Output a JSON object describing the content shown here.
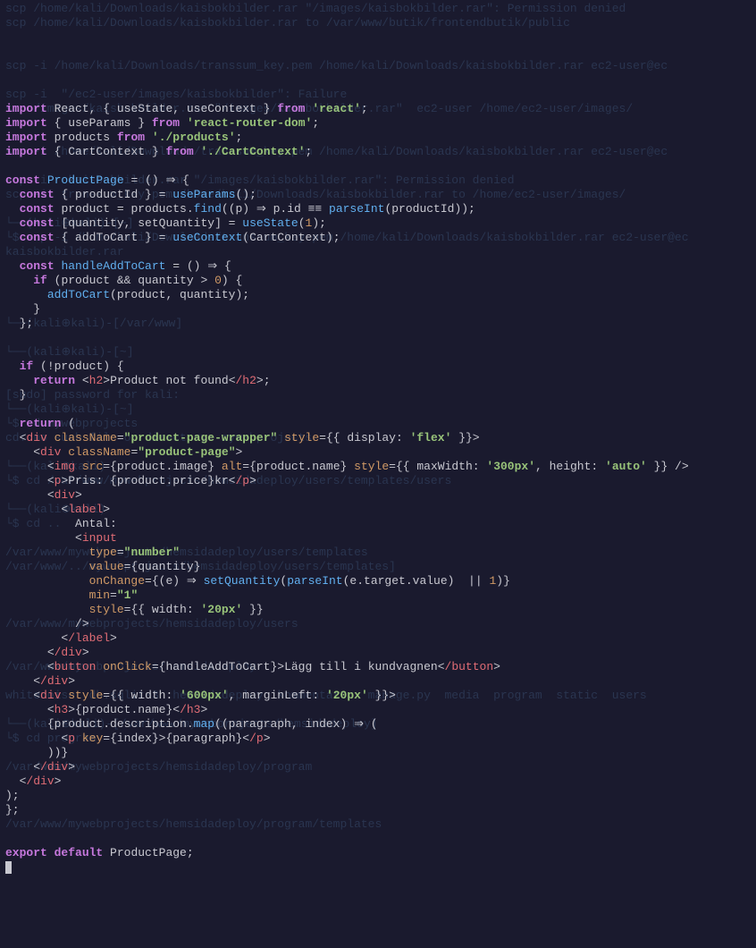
{
  "ghost_lines": [
    "scp /home/kali/Downloads/kaisbokbilder.rar \"/images/kaisbokbilder.rar\": Permission denied",
    "scp /home/kali/Downloads/kaisbokbilder.rar to /var/www/butik/frontendbutik/public",
    "",
    "",
    "scp -i /home/kali/Downloads/transsum_key.pem /home/kali/Downloads/kaisbokbilder.rar ec2-user@ec",
    "",
    "scp -i  \"/ec2-user/images/kaisbokbilder\": Failure",
    "scp /images/kaisbokbilder.rar \"/images/kaisbokbilder.rar\"  ec2-user /home/ec2-user/images/",
    "",
    "",
    "scp -i /home/kali/Downloads/transsum_key.pem /home/kali/Downloads/kaisbokbilder.rar ec2-user@ec",
    "",
    "scp -i   kaisbokbilder.rar \"/images/kaisbokbilder.rar\": Permission denied",
    "scp -i  transsum_key.pem /home/kali/Downloads/kaisbokbilder.rar to /home/ec2-user/images/",
    "",
    "└──(kali⊕kali)-[~]",
    "└$ scp -i /home/kali/Downloads/transsum_key.pem /home/kali/Downloads/kaisbokbilder.rar ec2-user@ec",
    "kaisbokbilder.rar",
    "",
    "",
    "",
    "",
    "└──(kali⊕kali)-[/var/www]",
    "",
    "└──(kali⊕kali)-[~]",
    "",
    "",
    "[sudo] password for kali:",
    "└──(kali⊕kali)-[~]",
    "└$ cd mywebprojects",
    "cd: no such file or directory: mywebprojects",
    "",
    "└──(kali⊕kali)",
    "└$ cd /var/www/mywebprojects/hemsidadeploy/users/templates/users",
    "",
    "└──(kali⊕kali)",
    "└$ cd ..",
    "",
    "/var/www/mywebprojects/hemsidadeploy/users/templates",
    "/var/www/../mywebprojects/hemsidadeploy/users/templates]",
    "",
    "",
    "",
    "/var/www/mywebprojects/hemsidadeploy/users",
    "",
    "",
    "/var/www/mywebprojects/hemsidadeploy",
    "",
    "whitenoise  db.sqlite3  hemsidadeploy  kommentarer  manage.py  media  program  static  users",
    "",
    "└──(kali⊕kali)-[/var/www/mywebprojects/hemsidadeploy]",
    "└$ cd program",
    "",
    "/var/www/mywebprojects/hemsidadeploy/program",
    "",
    "",
    "",
    "/var/www/mywebprojects/hemsidadeploy/program/templates"
  ],
  "code": {
    "l1": {
      "a": "import",
      "b": "React, { useState, useContext }",
      "c": "from",
      "d": "'react'",
      "e": ";"
    },
    "l2": {
      "a": "import",
      "b": "{ useParams }",
      "c": "from",
      "d": "'react-router-dom'",
      "e": ";"
    },
    "l3": {
      "a": "import",
      "b": "products",
      "c": "from",
      "d": "'./products'",
      "e": ";"
    },
    "l4": {
      "a": "import",
      "b": "{ CartContext }",
      "c": "from",
      "d": "'./CartContext'",
      "e": ";"
    },
    "l6": {
      "a": "const",
      "b": "ProductPage",
      "c": "= () ⇒ {"
    },
    "l7": {
      "a": "const",
      "b": "{ productId } =",
      "c": "useParams",
      "d": "();"
    },
    "l8": {
      "a": "const",
      "b": "product = products.",
      "c": "find",
      "d": "((p) ⇒ p.id ≡≡",
      "e": "parseInt",
      "f": "(productId));"
    },
    "l9": {
      "a": "const",
      "b": "[quantity, setQuantity] =",
      "c": "useState",
      "d": "(",
      "e": "1",
      "f": ");"
    },
    "l10": {
      "a": "const",
      "b": "{ addToCart } =",
      "c": "useContext",
      "d": "(CartContext);"
    },
    "l12": {
      "a": "const",
      "b": "handleAddToCart",
      "c": "= () ⇒ {"
    },
    "l13": {
      "a": "if",
      "b": "(product && quantity >",
      "c": "0",
      "d": ") {"
    },
    "l14": {
      "a": "addToCart",
      "b": "(product, quantity);"
    },
    "l15": {
      "a": "}"
    },
    "l16": {
      "a": "};"
    },
    "l19": {
      "a": "if",
      "b": "(!product) {"
    },
    "l20": {
      "a": "return",
      "b": "<",
      "c": "h2",
      "d": ">Product not found<",
      "e": "/h2",
      "f": ">;"
    },
    "l21": {
      "a": "}"
    },
    "l23": {
      "a": "return",
      "b": "("
    },
    "l24": {
      "a": "<",
      "b": "div",
      "c": "className",
      "d": "=",
      "e": "\"product-page-wrapper\"",
      "f": "style",
      "g": "={{ display:",
      "h": "'flex'",
      "i": "}}>"
    },
    "l25": {
      "a": "<",
      "b": "div",
      "c": "className",
      "d": "=",
      "e": "\"product-page\"",
      "f": ">"
    },
    "l26": {
      "a": "<",
      "b": "img",
      "c": "src",
      "d": "={product.image}",
      "e": "alt",
      "f": "={product.name}",
      "g": "style",
      "h": "={{ maxWidth:",
      "i": "'300px'",
      "j": ", height:",
      "k": "'auto'",
      "l": "}} />"
    },
    "l27": {
      "a": "<",
      "b": "p",
      "c": ">Pris: {product.price}kr<",
      "d": "/p",
      "e": ">"
    },
    "l28": {
      "a": "<",
      "b": "div",
      "c": ">"
    },
    "l29": {
      "a": "<",
      "b": "label",
      "c": ">"
    },
    "l30": {
      "a": "Antal:"
    },
    "l31": {
      "a": "<",
      "b": "input"
    },
    "l32": {
      "a": "type",
      "b": "=",
      "c": "\"number\""
    },
    "l33": {
      "a": "value",
      "b": "={quantity}"
    },
    "l34": {
      "a": "onChange",
      "b": "={(e) ⇒",
      "c": "setQuantity",
      "d": "(",
      "e": "parseInt",
      "f": "(e.target.value)  ||",
      "g": "1",
      "h": ")}"
    },
    "l35": {
      "a": "min",
      "b": "=",
      "c": "\"1\""
    },
    "l36": {
      "a": "style",
      "b": "={{ width:",
      "c": "'20px'",
      "d": "}}"
    },
    "l37": {
      "a": "/>"
    },
    "l38": {
      "a": "<",
      "b": "/label",
      "c": ">"
    },
    "l39": {
      "a": "<",
      "b": "/div",
      "c": ">"
    },
    "l40": {
      "a": "<",
      "b": "button",
      "c": "onClick",
      "d": "={handleAddToCart}>Lägg till i kundvagnen<",
      "e": "/button",
      "f": ">"
    },
    "l41": {
      "a": "<",
      "b": "/div",
      "c": ">"
    },
    "l42": {
      "a": "<",
      "b": "div",
      "c": "style",
      "d": "={{ width:",
      "e": "'600px'",
      "f": ", marginLeft:",
      "g": "'20px'",
      "h": "}}>"
    },
    "l43": {
      "a": "<",
      "b": "h3",
      "c": ">{product.name}<",
      "d": "/h3",
      "e": ">"
    },
    "l44": {
      "a": "{product.description.",
      "b": "map",
      "c": "((paragraph, index) ⇒ ("
    },
    "l45": {
      "a": "<",
      "b": "p",
      "c": "key",
      "d": "={index}>{paragraph}<",
      "e": "/p",
      "f": ">"
    },
    "l46": {
      "a": "))}"
    },
    "l47": {
      "a": "<",
      "b": "/div",
      "c": ">"
    },
    "l48": {
      "a": "<",
      "b": "/div",
      "c": ">"
    },
    "l49": {
      "a": ");"
    },
    "l50": {
      "a": "};"
    },
    "l53": {
      "a": "export",
      "b": "default",
      "c": "ProductPage;"
    }
  }
}
